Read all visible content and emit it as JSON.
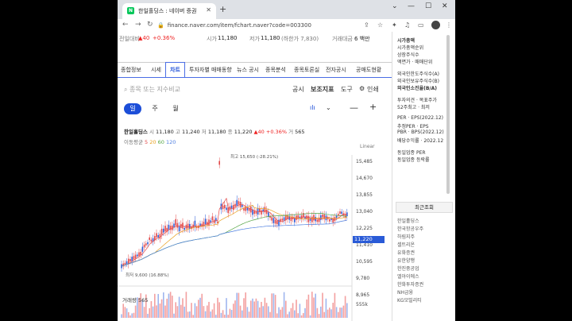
{
  "browser": {
    "tab_title": "한일홀딩스 : 네이버 증권",
    "favicon_letter": "N",
    "url": "finance.naver.com/item/fchart.naver?code=003300"
  },
  "price_bar": {
    "prev_label": "전일대비",
    "change": "▲40",
    "change_pct": "+0.36%",
    "open_label": "시가",
    "open": "11,180",
    "low_label": "저가",
    "low": "11,180",
    "low_note": "(하한가 7,830)",
    "amount_label": "거래대금",
    "amount": "6 백만"
  },
  "menu": [
    "종합정보",
    "시세",
    "차트",
    "투자자별 매매동향",
    "뉴스 공시",
    "종목분석",
    "종목토론실",
    "전자공시",
    "공매도현황"
  ],
  "search": {
    "placeholder": "종목 또는 지수비교"
  },
  "tools": {
    "notice": "공시",
    "indicator": "보조지표",
    "tool": "도구",
    "print": "인쇄"
  },
  "periods": [
    "일",
    "주",
    "월"
  ],
  "legend": {
    "name": "한일홀딩스",
    "open_label": "시",
    "open": "11,180",
    "high_label": "고",
    "high": "11,240",
    "low_label": "저",
    "low": "11,180",
    "close_label": "종",
    "close": "11,220",
    "change": "▲40",
    "pct": "+0.36%",
    "vol_label": "거",
    "vol": "565",
    "ma_label": "이동평균",
    "ma": [
      "5",
      "20",
      "60",
      "120"
    ]
  },
  "chart_data": {
    "type": "line",
    "scale": "Linear",
    "y_ticks": [
      "15,485",
      "14,670",
      "13,855",
      "13,040",
      "12,225",
      "11,410",
      "10,595",
      "9,780",
      "8,965"
    ],
    "current": "11,220",
    "max_annotation": "최고 15,650 (-28.21%)",
    "min_annotation": "최저 9,600 (16.88%)",
    "volume_label": "거래량 565",
    "volume_tick": "555k",
    "series": [
      {
        "name": "5",
        "color": "#e24848"
      },
      {
        "name": "20",
        "color": "#e8a020"
      },
      {
        "name": "60",
        "color": "#55a545"
      },
      {
        "name": "120",
        "color": "#5080e0"
      }
    ]
  },
  "sidebar": {
    "items": [
      {
        "text": "시가총액",
        "bold": true
      },
      {
        "text": "시가총액순위"
      },
      {
        "text": "상장주식수"
      },
      {
        "text": "액면가 · 매매단위"
      },
      {
        "text": "외국인한도주식수(A)"
      },
      {
        "text": "외국인보유주식수(B)"
      },
      {
        "text": "외국인소진율(B/A)",
        "bold": true
      },
      {
        "text": "투자의견 · 목표주가"
      },
      {
        "text": "52주최고 · 최저"
      },
      {
        "text": "PER · EPS(2022.12)"
      },
      {
        "text": "추정PER · EPS"
      },
      {
        "text": "PBR · BPS(2022.12)"
      },
      {
        "text": "배당수익률 · 2022.12"
      },
      {
        "text": "동일업종 PER"
      },
      {
        "text": "동일업종 등락률"
      }
    ],
    "recent_label": "최근조회",
    "recent": [
      "한일홀딩스",
      "한국항공우주",
      "하림지주",
      "셀트리온",
      "유화증권",
      "유한양행",
      "한진중공업",
      "엘아이에스",
      "한화투자증권",
      "NH금융",
      "KG모빌리티"
    ]
  }
}
